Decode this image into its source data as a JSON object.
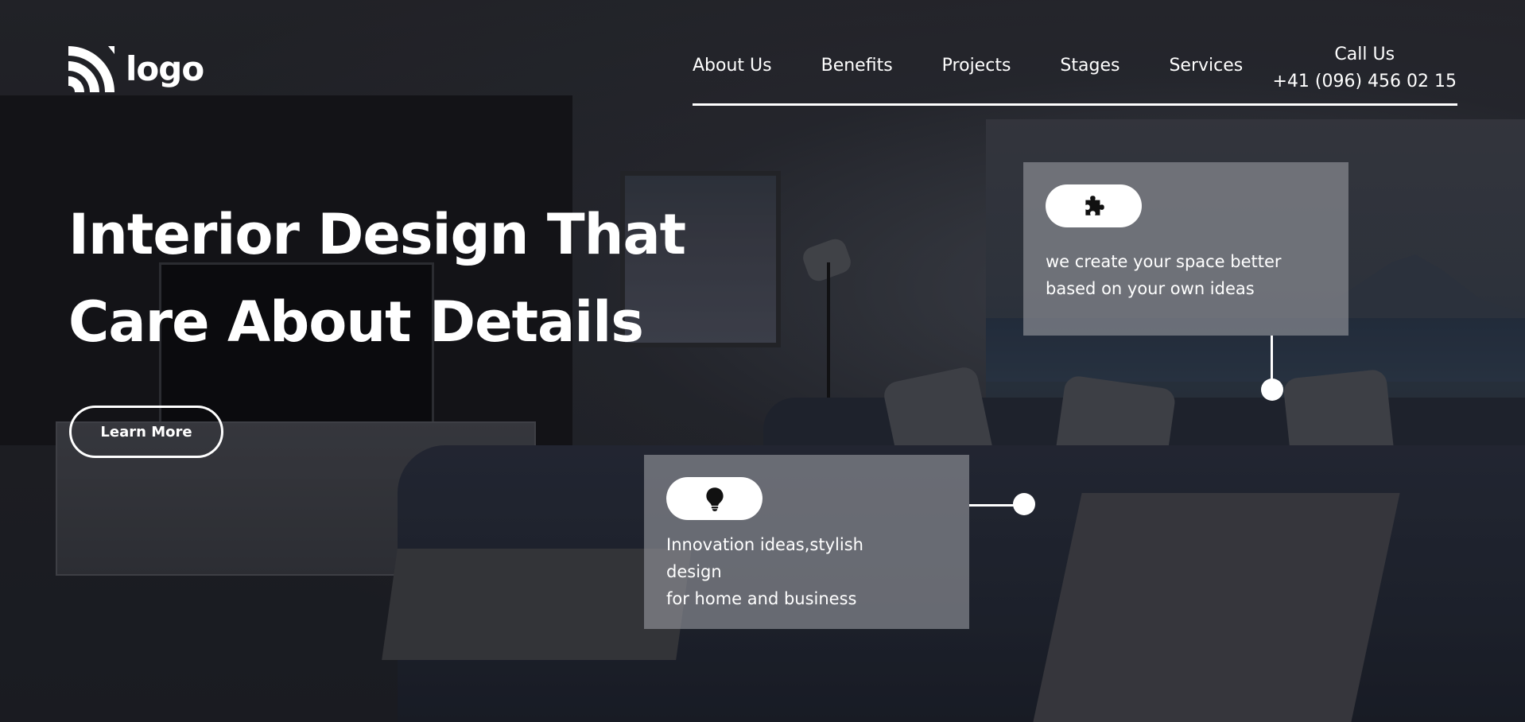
{
  "header": {
    "logo_text": "logo",
    "nav": [
      {
        "label": "About Us"
      },
      {
        "label": "Benefits"
      },
      {
        "label": "Projects"
      },
      {
        "label": "Stages"
      },
      {
        "label": "Services"
      }
    ],
    "call_label": "Call Us",
    "call_phone": "+41 (096) 456 02 15"
  },
  "hero": {
    "title_line1": "Interior Design That",
    "title_line2": "Care About Details",
    "cta_label": "Learn More"
  },
  "cards": [
    {
      "icon": "puzzle-icon",
      "text": "we create your space better\nbased on your own ideas"
    },
    {
      "icon": "lightbulb-icon",
      "text": "Innovation ideas,stylish\ndesign\nfor home and business"
    }
  ],
  "colors": {
    "text": "#ffffff",
    "card_bg": "#96989e",
    "page_bg": "#1b1c20"
  }
}
